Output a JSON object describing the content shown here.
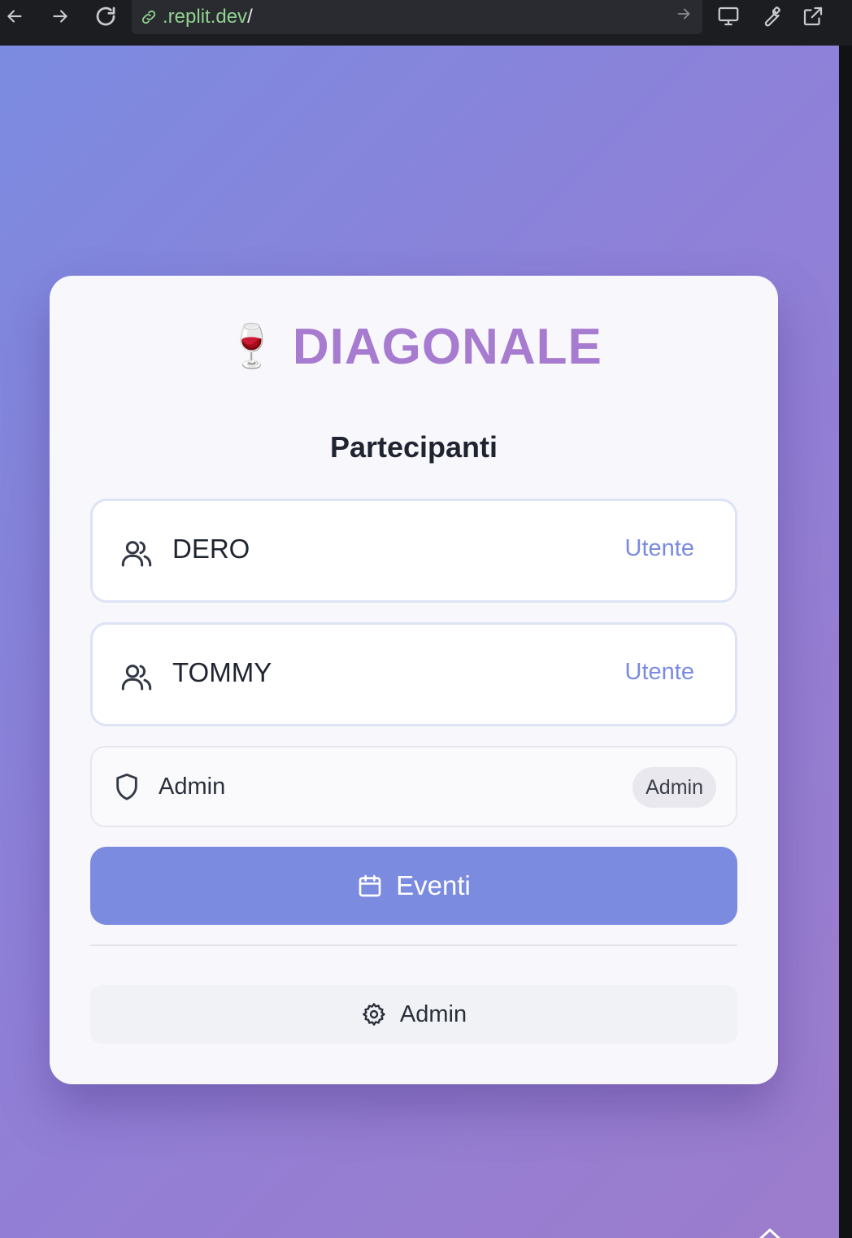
{
  "browser": {
    "url_host": ".replit.dev",
    "url_path": "/"
  },
  "app": {
    "brand_emoji": "🍷",
    "brand_name": "DIAGONALE",
    "section_title": "Partecipanti",
    "participants": [
      {
        "name": "DERO",
        "role": "Utente",
        "icon": "users-icon"
      },
      {
        "name": "TOMMY",
        "role": "Utente",
        "icon": "users-icon"
      }
    ],
    "admin_row": {
      "name": "Admin",
      "badge": "Admin",
      "icon": "shield-icon"
    },
    "eventi_button": {
      "label": "Eventi",
      "icon": "calendar-icon"
    },
    "admin_button": {
      "label": "Admin",
      "icon": "gear-icon"
    }
  },
  "colors": {
    "accent": "#7b8be0",
    "brand": "#a77bd0",
    "role_text": "#7a8ae0"
  }
}
